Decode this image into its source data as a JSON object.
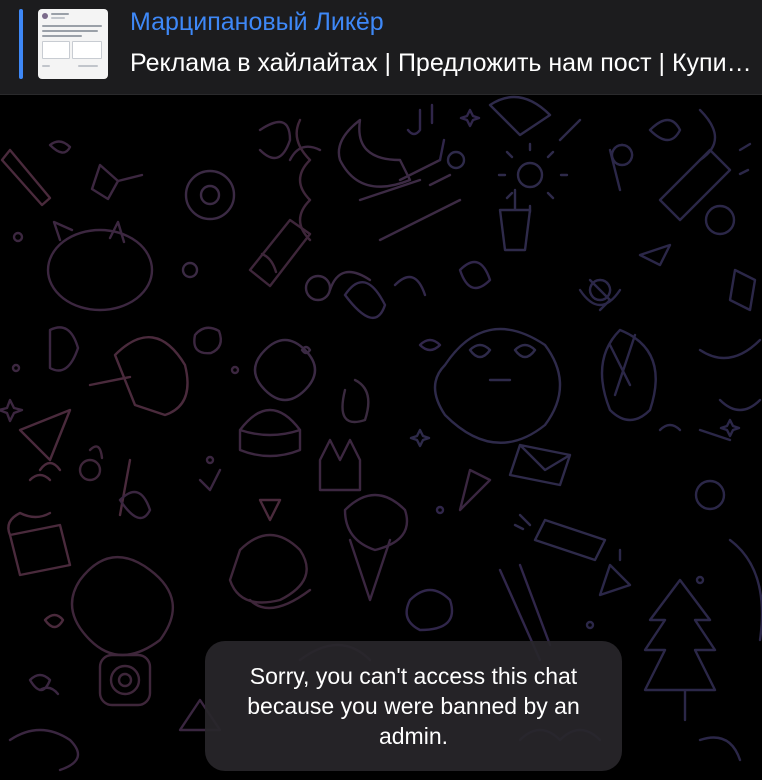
{
  "pinned": {
    "title": "Марципановый Ликёр",
    "text": "Реклама в хайлайтах | Предложить нам пост | Купить рекламу",
    "thumbnail_icon": "tweet-screenshot-thumbnail"
  },
  "notice": {
    "text": "Sorry, you can't access this chat because you were banned by an admin."
  },
  "colors": {
    "accent": "#3e88f7",
    "background": "#000000",
    "doodle_warm": "#4a2a3c",
    "doodle_cool": "#2b2748",
    "notice_bg": "#28262a"
  }
}
